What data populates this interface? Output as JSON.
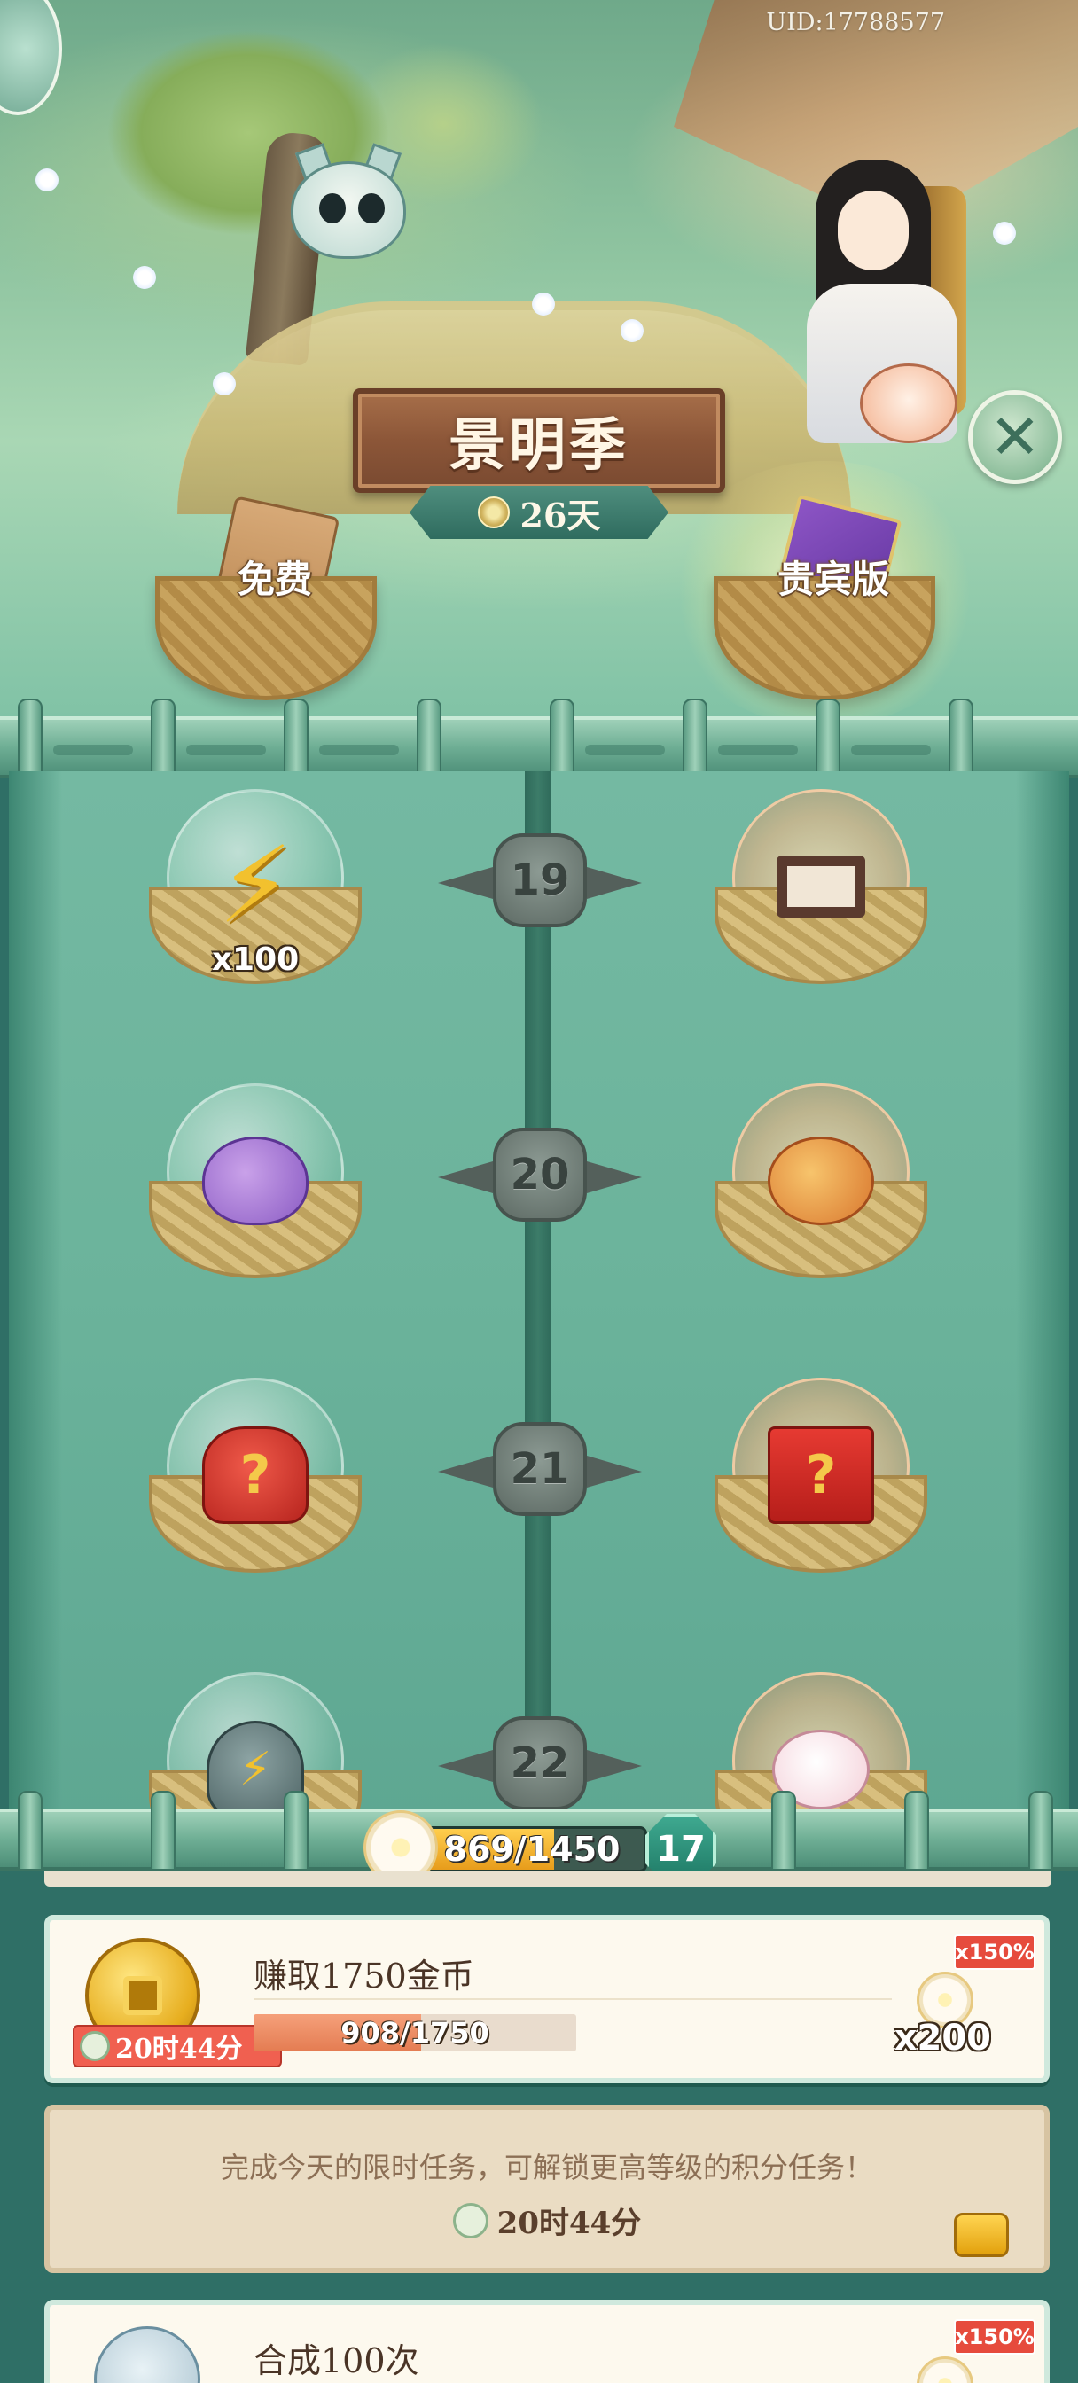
{
  "header": {
    "uid": "UID:17788577",
    "season_title": "景明季",
    "days_remaining": "26天"
  },
  "tiers": {
    "free_label": "免费",
    "vip_label": "贵宾版"
  },
  "levels": [
    {
      "level": "19",
      "free": {
        "item": "stamina-bolt-icon",
        "qty": "x100"
      },
      "vip": {
        "item": "tofu-box-icon"
      }
    },
    {
      "level": "20",
      "free": {
        "item": "purple-pouch-icon"
      },
      "vip": {
        "item": "roast-chicken-bowl-icon"
      }
    },
    {
      "level": "21",
      "free": {
        "item": "mystery-red-bag-icon",
        "glyph": "?"
      },
      "vip": {
        "item": "mystery-gift-box-icon",
        "glyph": "?"
      }
    },
    {
      "level": "22",
      "free": {
        "item": "incense-burner-icon",
        "glyph": "⚡"
      },
      "vip": {
        "item": "bunny-cake-icon"
      }
    }
  ],
  "progress": {
    "text": "869/1450",
    "current": 869,
    "max": 1450,
    "level": "17"
  },
  "tasks": [
    {
      "title": "赚取1750金币",
      "timer": "20时44分",
      "progress_text": "908/1750",
      "current": 908,
      "target": 1750,
      "bonus": "x150%",
      "reward_qty": "x200"
    },
    {
      "title": "合成100次",
      "bonus": "x150%"
    }
  ],
  "locked": {
    "message": "完成今天的限时任务，可解锁更高等级的积分任务！",
    "timer": "20时44分"
  },
  "colors": {
    "accent_teal": "#2f6f66",
    "bonus_red": "#e64b3d",
    "progress_gold": "#e79c1b"
  }
}
